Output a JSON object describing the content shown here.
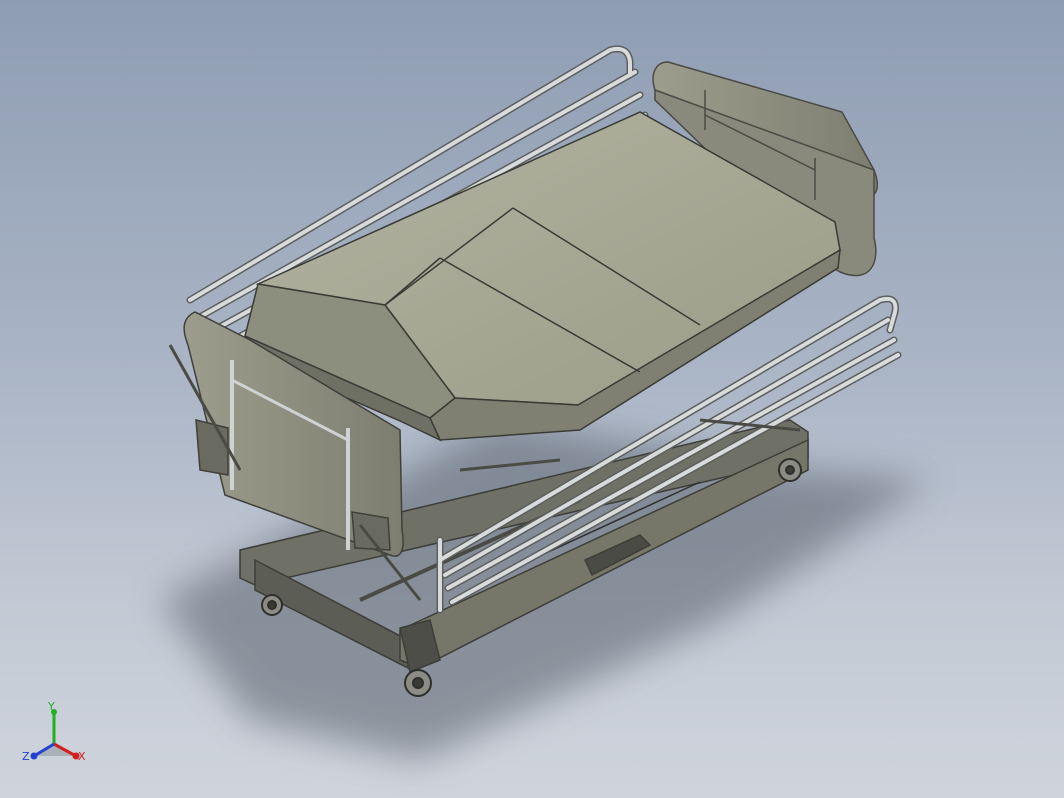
{
  "viewport": {
    "background_top": "#8f9db3",
    "background_bottom": "#cfd4dc"
  },
  "model": {
    "subject": "hospital-bed-assembly",
    "colors": {
      "mattress": "#a9ab98",
      "mattress_dark": "#7f8072",
      "panel": "#8e8f80",
      "metal": "#c9cccd",
      "frame": "#6f7066",
      "shadow": "#59606c"
    }
  },
  "triad": {
    "x_label": "X",
    "y_label": "Y",
    "z_label": "Z",
    "x_color": "#d21f1f",
    "y_color": "#20b020",
    "z_color": "#2340d0"
  }
}
